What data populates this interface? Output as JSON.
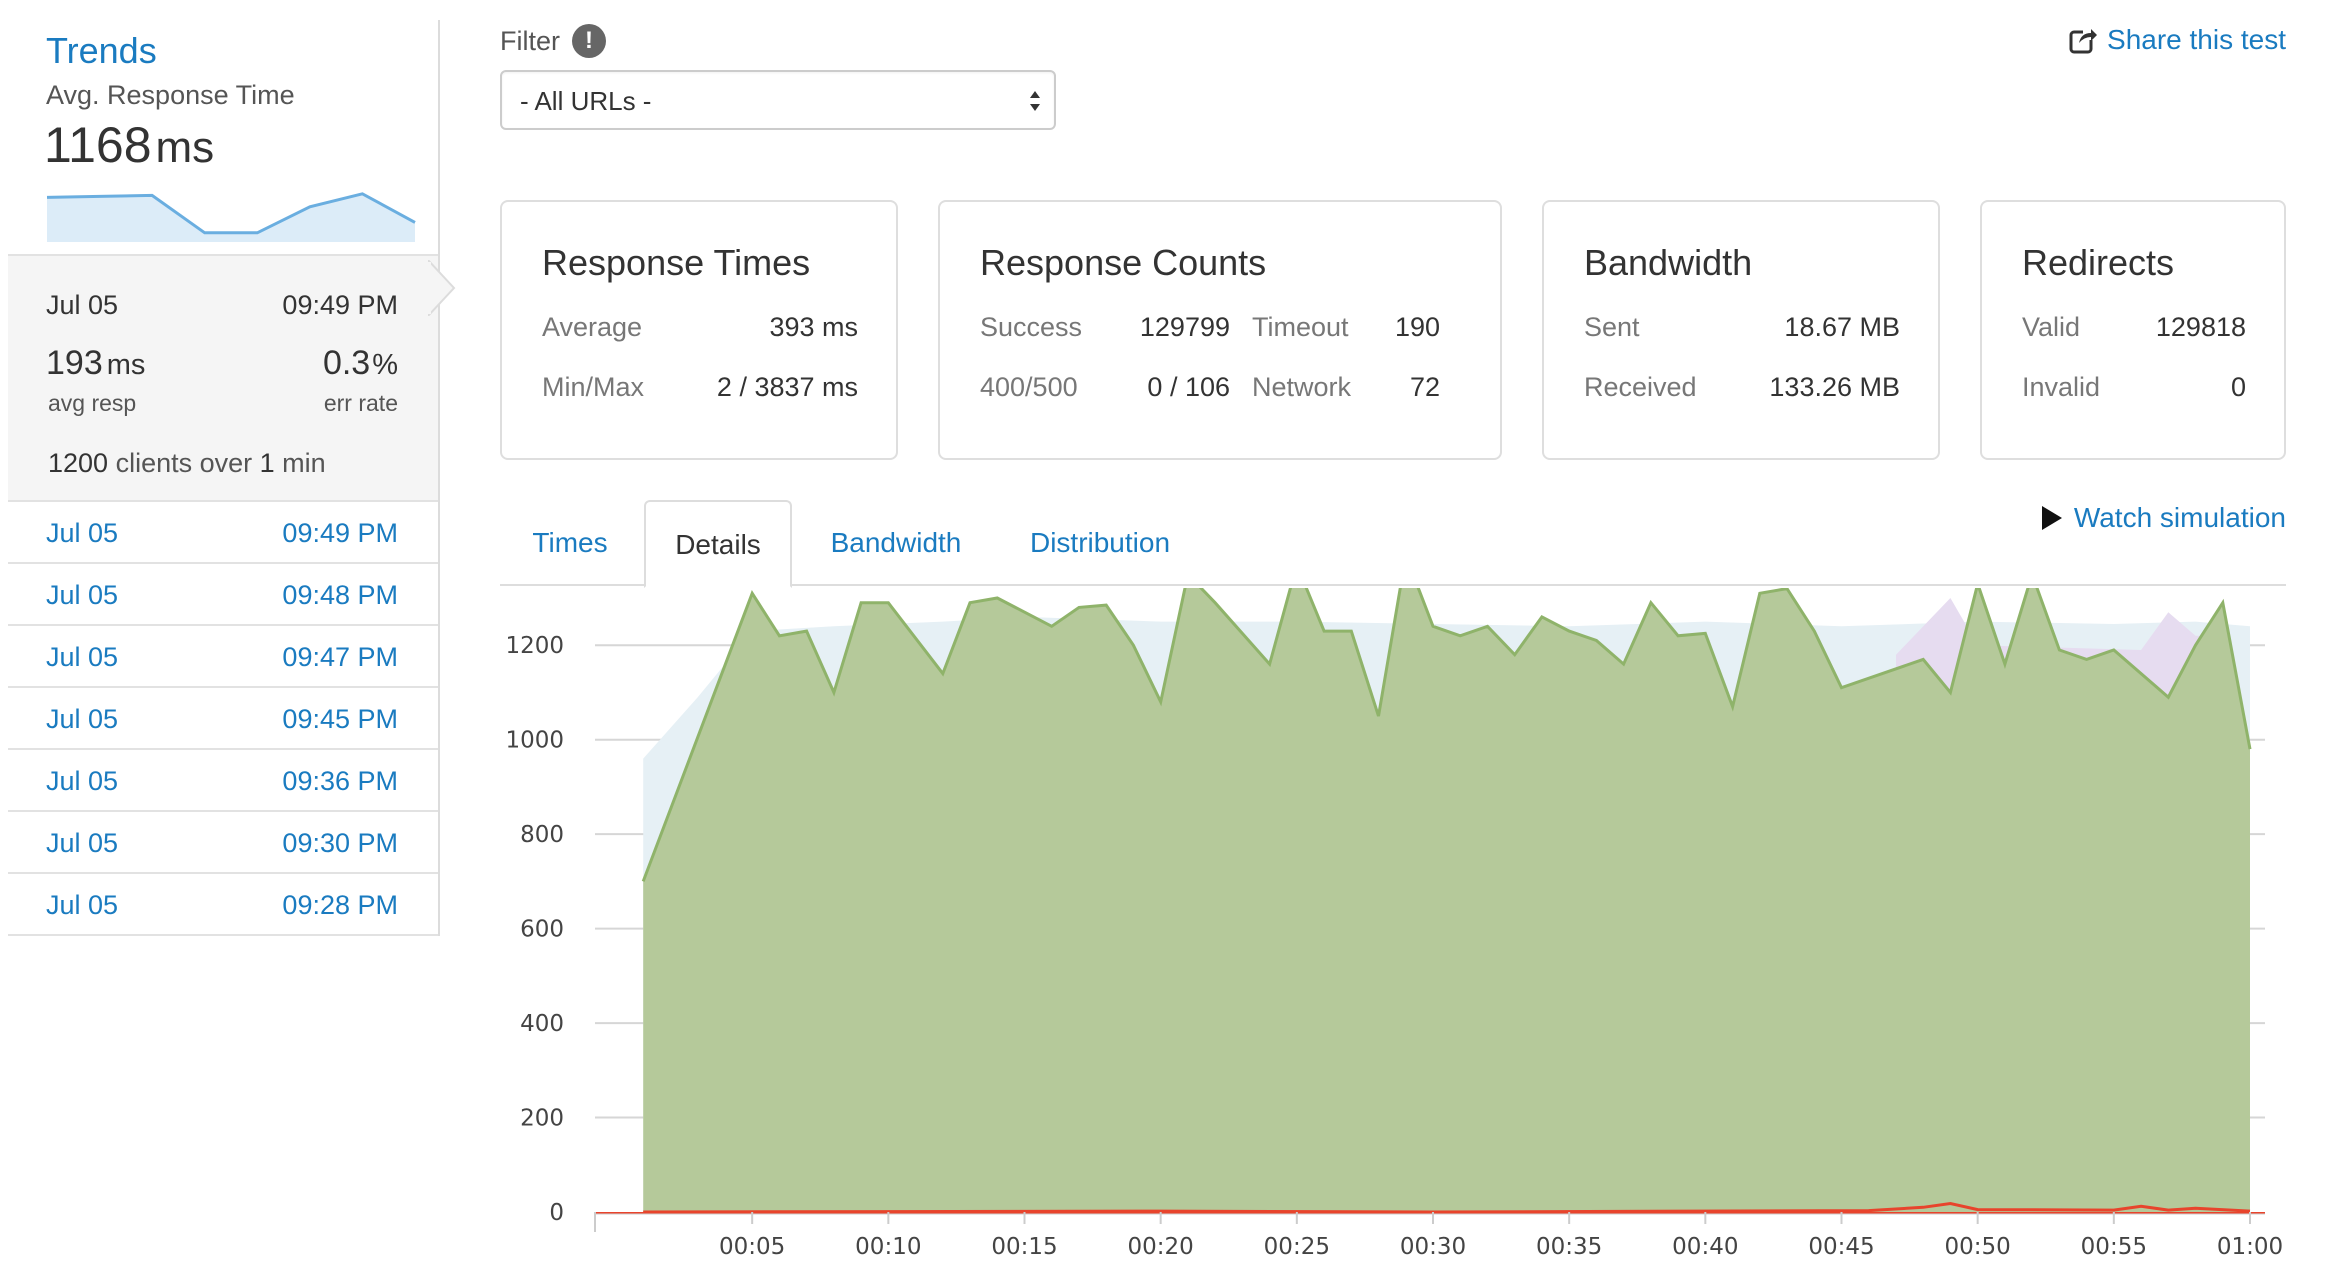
{
  "sidebar": {
    "trends_title": "Trends",
    "trends_subtitle": "Avg. Response Time",
    "trends_value": "1168",
    "trends_unit": "ms",
    "sparkline": [
      0.78,
      0.8,
      0.82,
      0.1,
      0.1,
      0.6,
      0.85,
      0.3
    ],
    "current": {
      "date": "Jul 05",
      "time": "09:49 PM",
      "avg_resp": "193",
      "avg_resp_unit": "ms",
      "avg_resp_label": "avg resp",
      "err_rate": "0.3",
      "err_rate_unit": "%",
      "err_rate_label": "err rate",
      "clients": "1200",
      "clients_mid": " clients over ",
      "duration": "1",
      "duration_unit": " min"
    },
    "runs": [
      {
        "date": "Jul 05",
        "time": "09:49 PM"
      },
      {
        "date": "Jul 05",
        "time": "09:48 PM"
      },
      {
        "date": "Jul 05",
        "time": "09:47 PM"
      },
      {
        "date": "Jul 05",
        "time": "09:45 PM"
      },
      {
        "date": "Jul 05",
        "time": "09:36 PM"
      },
      {
        "date": "Jul 05",
        "time": "09:30 PM"
      },
      {
        "date": "Jul 05",
        "time": "09:28 PM"
      }
    ]
  },
  "filter": {
    "label": "Filter",
    "info_glyph": "!",
    "selected": "- All URLs -"
  },
  "share_label": "Share this test",
  "cards": {
    "response_times": {
      "title": "Response Times",
      "average_label": "Average",
      "average_value": "393 ms",
      "minmax_label": "Min/Max",
      "minmax_value": "2 / 3837 ms"
    },
    "response_counts": {
      "title": "Response Counts",
      "success_label": "Success",
      "success_value": "129799",
      "timeout_label": "Timeout",
      "timeout_value": "190",
      "e400_label": "400/500",
      "e400_value": "0 / 106",
      "network_label": "Network",
      "network_value": "72"
    },
    "bandwidth": {
      "title": "Bandwidth",
      "sent_label": "Sent",
      "sent_value": "18.67 MB",
      "received_label": "Received",
      "received_value": "133.26 MB"
    },
    "redirects": {
      "title": "Redirects",
      "valid_label": "Valid",
      "valid_value": "129818",
      "invalid_label": "Invalid",
      "invalid_value": "0"
    }
  },
  "tabs": [
    {
      "label": "Times",
      "active": false
    },
    {
      "label": "Details",
      "active": true
    },
    {
      "label": "Bandwidth",
      "active": false
    },
    {
      "label": "Distribution",
      "active": false
    }
  ],
  "watch_label": "Watch simulation",
  "colors": {
    "link": "#1a7bc0",
    "success_fill": "#b5c99a",
    "success_line": "#8fb36a",
    "light_fill": "#e6f0f5",
    "purple_fill": "#e6dcf0",
    "error_line": "#e8442c"
  },
  "chart_data": {
    "type": "area",
    "ylim": [
      0,
      1300
    ],
    "yticks": [
      0,
      200,
      400,
      600,
      800,
      1000,
      1200
    ],
    "xlim_seconds": [
      0,
      60
    ],
    "xticks": [
      "00:05",
      "00:10",
      "00:15",
      "00:20",
      "00:25",
      "00:30",
      "00:35",
      "00:40",
      "00:45",
      "00:50",
      "00:55",
      "01:00"
    ],
    "series": [
      {
        "values": [
          [
            1,
            700
          ],
          [
            5,
            1310
          ],
          [
            6,
            1220
          ],
          [
            7,
            1230
          ],
          [
            8,
            1100
          ],
          [
            9,
            1290
          ],
          [
            10,
            1290
          ],
          [
            12,
            1140
          ],
          [
            13,
            1290
          ],
          [
            14,
            1300
          ],
          [
            16,
            1240
          ],
          [
            17,
            1280
          ],
          [
            18,
            1285
          ],
          [
            19,
            1200
          ],
          [
            20,
            1080
          ],
          [
            21,
            1350
          ],
          [
            22,
            1290
          ],
          [
            24,
            1160
          ],
          [
            25,
            1370
          ],
          [
            26,
            1230
          ],
          [
            27,
            1230
          ],
          [
            28,
            1050
          ],
          [
            29,
            1390
          ],
          [
            30,
            1240
          ],
          [
            31,
            1220
          ],
          [
            32,
            1240
          ],
          [
            33,
            1180
          ],
          [
            34,
            1260
          ],
          [
            35,
            1230
          ],
          [
            36,
            1210
          ],
          [
            37,
            1160
          ],
          [
            38,
            1290
          ],
          [
            39,
            1220
          ],
          [
            40,
            1225
          ],
          [
            41,
            1070
          ],
          [
            42,
            1310
          ],
          [
            43,
            1320
          ],
          [
            44,
            1230
          ],
          [
            45,
            1110
          ],
          [
            48,
            1170
          ],
          [
            49,
            1100
          ],
          [
            50,
            1330
          ],
          [
            51,
            1160
          ],
          [
            52,
            1350
          ],
          [
            53,
            1190
          ],
          [
            54,
            1170
          ],
          [
            55,
            1190
          ],
          [
            57,
            1090
          ],
          [
            58,
            1200
          ],
          [
            59,
            1290
          ],
          [
            60,
            980
          ]
        ]
      },
      {
        "values": [
          [
            1,
            960
          ],
          [
            3,
            1090
          ],
          [
            5,
            1230
          ],
          [
            8,
            1240
          ],
          [
            12,
            1250
          ],
          [
            15,
            1260
          ],
          [
            20,
            1250
          ],
          [
            25,
            1250
          ],
          [
            30,
            1245
          ],
          [
            35,
            1240
          ],
          [
            40,
            1250
          ],
          [
            45,
            1240
          ],
          [
            50,
            1250
          ],
          [
            55,
            1245
          ],
          [
            58,
            1250
          ],
          [
            60,
            1240
          ]
        ]
      },
      {
        "values": [
          [
            47,
            1180
          ],
          [
            49,
            1300
          ],
          [
            50,
            1200
          ],
          [
            56,
            1190
          ],
          [
            57,
            1270
          ],
          [
            58,
            1220
          ],
          [
            59,
            1220
          ]
        ]
      },
      {
        "values": [
          [
            1,
            0
          ],
          [
            20,
            2
          ],
          [
            30,
            0
          ],
          [
            46,
            3
          ],
          [
            48,
            10
          ],
          [
            49,
            18
          ],
          [
            50,
            5
          ],
          [
            55,
            4
          ],
          [
            56,
            12
          ],
          [
            57,
            4
          ],
          [
            58,
            8
          ],
          [
            60,
            2
          ]
        ]
      }
    ]
  }
}
